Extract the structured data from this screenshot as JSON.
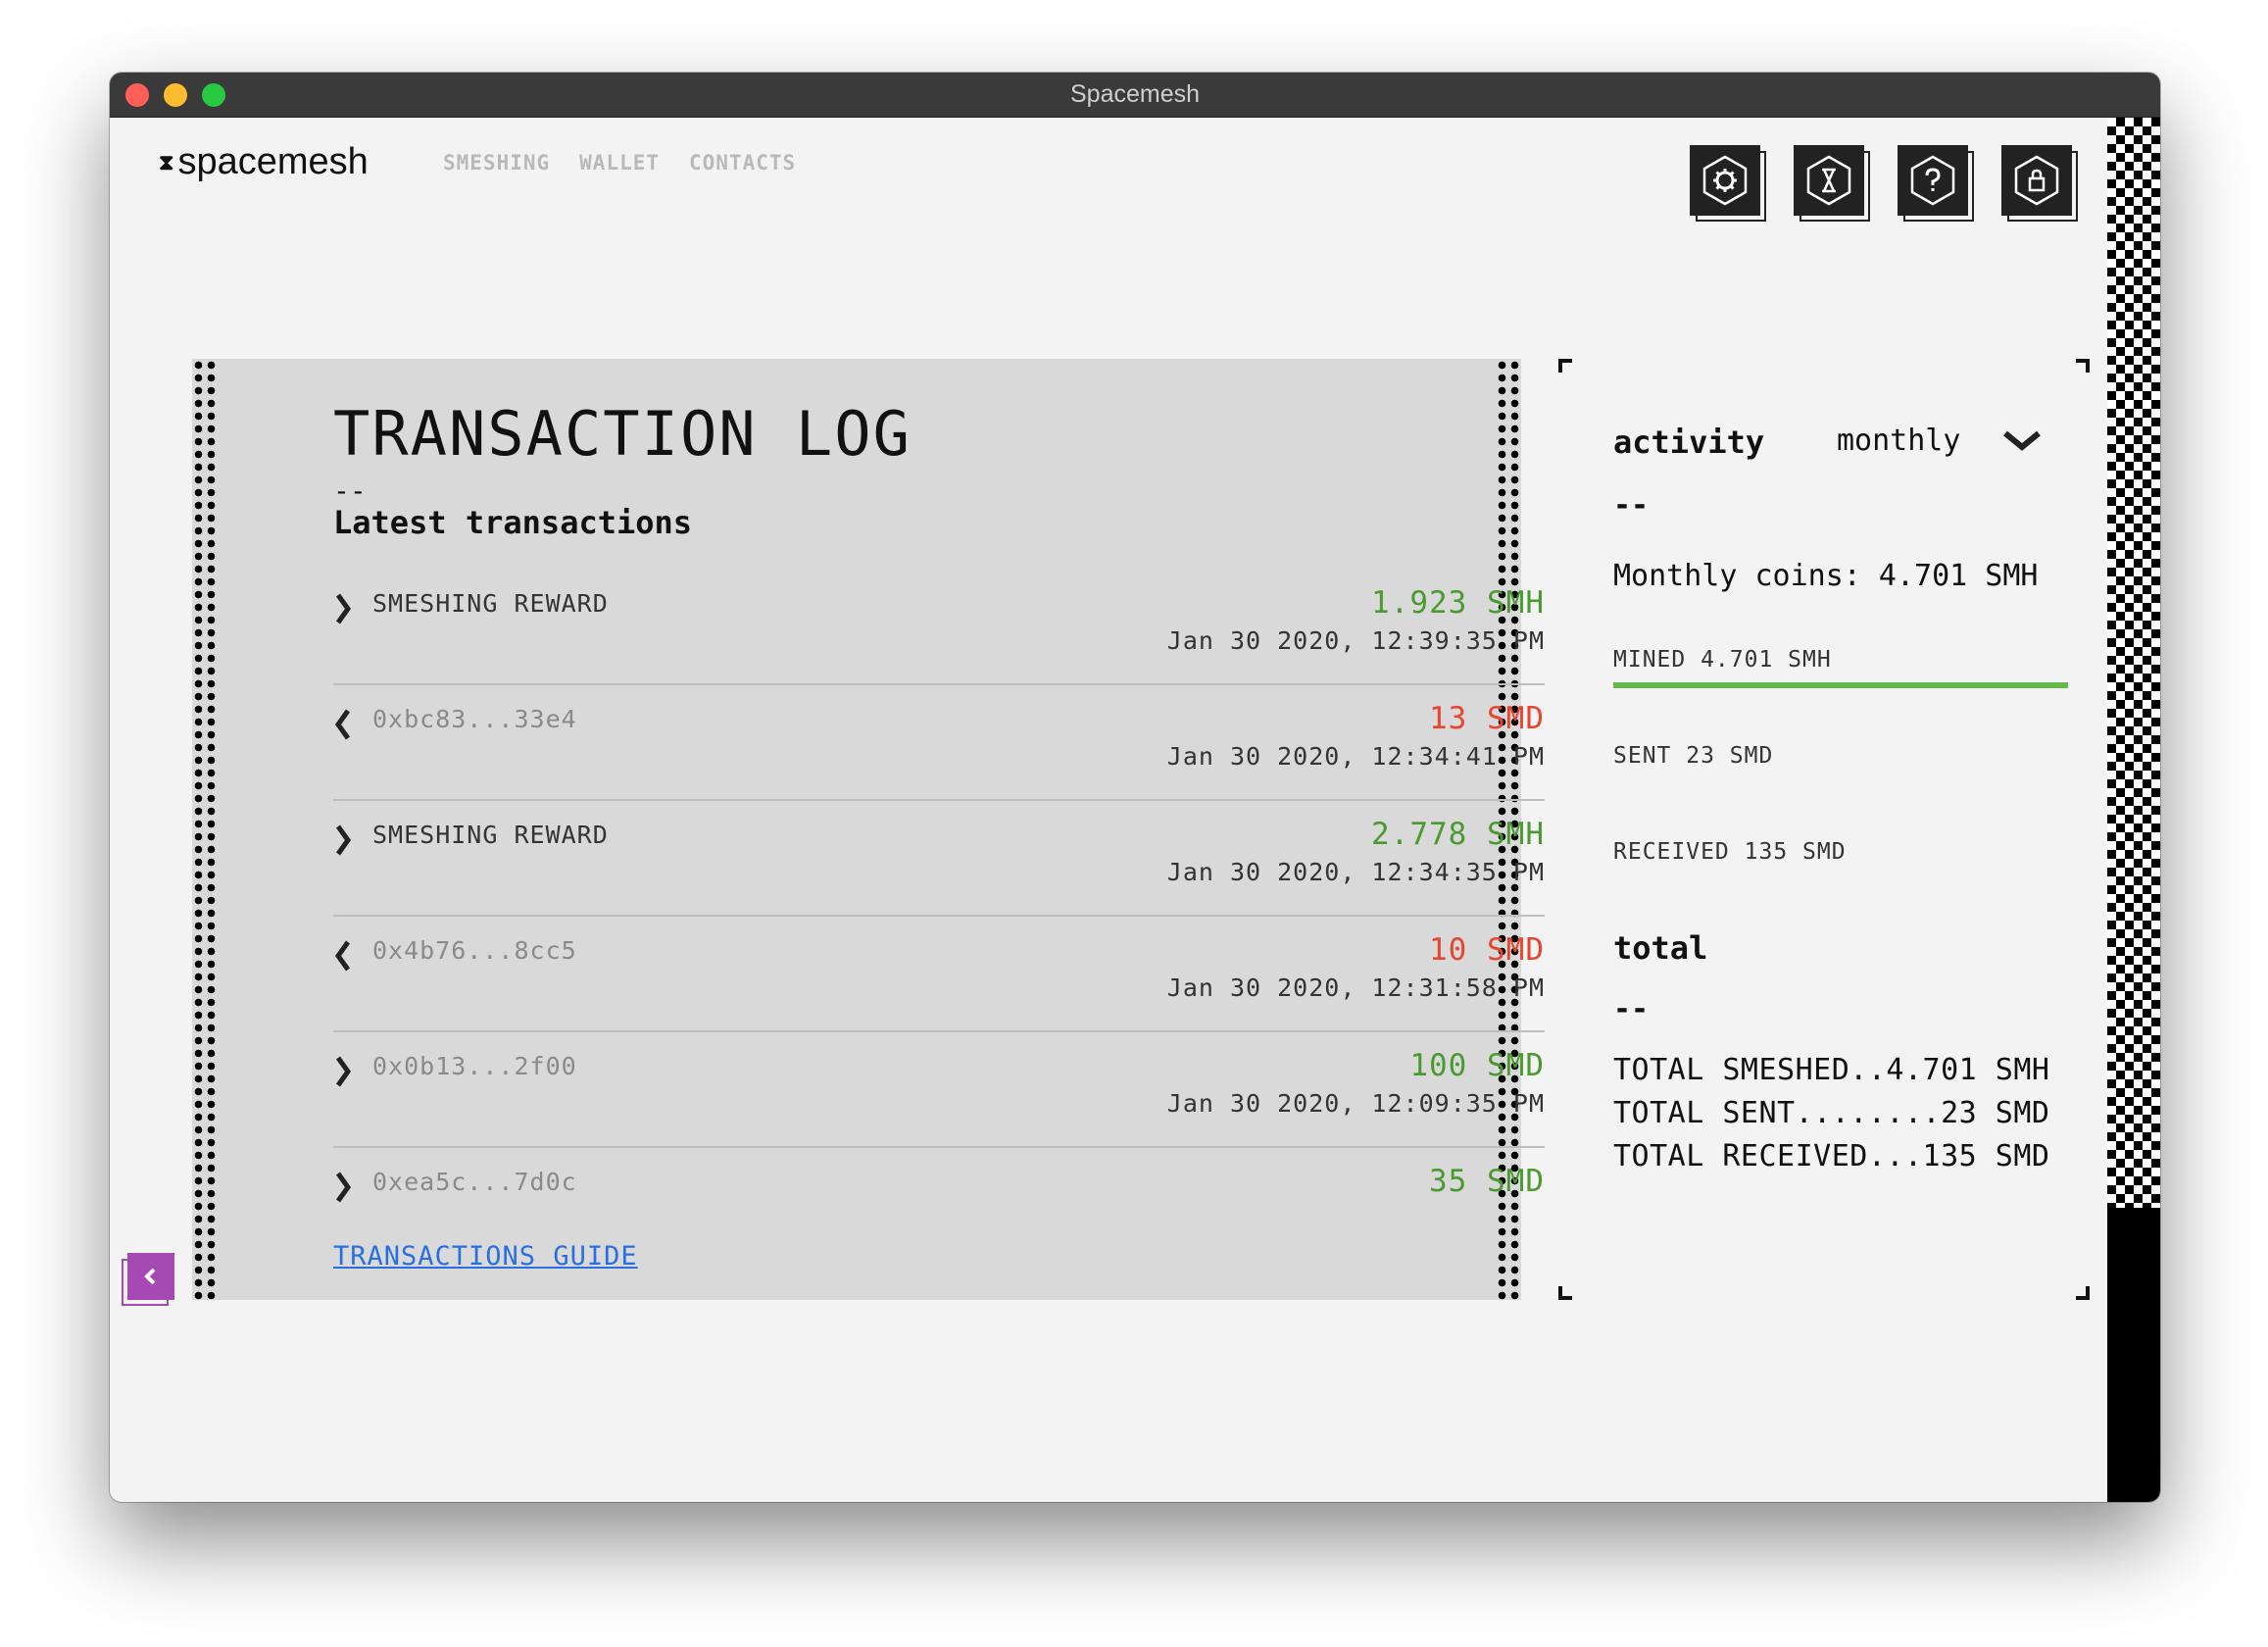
{
  "window": {
    "title": "Spacemesh"
  },
  "header": {
    "logo": "spacemesh",
    "nav": [
      "SMESHING",
      "WALLET",
      "CONTACTS"
    ],
    "icons": [
      "gear-icon",
      "hourglass-icon",
      "help-icon",
      "lock-icon"
    ]
  },
  "log": {
    "title": "TRANSACTION LOG",
    "dash": "--",
    "subtitle": "Latest transactions",
    "transactions": [
      {
        "direction": "in",
        "label": "SMESHING REWARD",
        "amount": "1.923 SMH",
        "date": "Jan 30 2020, 12:39:35 PM",
        "color": "#4a9a31"
      },
      {
        "direction": "out",
        "label": "0xbc83...33e4",
        "amount": "13 SMD",
        "date": "Jan 30 2020, 12:34:41 PM",
        "color": "#e8452f"
      },
      {
        "direction": "in",
        "label": "SMESHING REWARD",
        "amount": "2.778 SMH",
        "date": "Jan 30 2020, 12:34:35 PM",
        "color": "#4a9a31"
      },
      {
        "direction": "out",
        "label": "0x4b76...8cc5",
        "amount": "10 SMD",
        "date": "Jan 30 2020, 12:31:58 PM",
        "color": "#e8452f"
      },
      {
        "direction": "in",
        "label": "0x0b13...2f00",
        "amount": "100 SMD",
        "date": "Jan 30 2020, 12:09:35 PM",
        "color": "#4a9a31"
      },
      {
        "direction": "in",
        "label": "0xea5c...7d0c",
        "amount": "35 SMD",
        "date": "",
        "color": "#4a9a31"
      }
    ],
    "guide_link": "TRANSACTIONS GUIDE"
  },
  "activity": {
    "title": "activity",
    "period": "monthly",
    "dash": "--",
    "monthly_coins": "Monthly coins: 4.701 SMH",
    "mined": "MINED 4.701 SMH",
    "mined_fraction": 1.0,
    "sent": "SENT 23 SMD",
    "received": "RECEIVED 135 SMD",
    "total_title": "total",
    "total_dash": "--",
    "totals": [
      "TOTAL SMESHED..4.701 SMH",
      "TOTAL SENT........23 SMD",
      "TOTAL RECEIVED...135 SMD"
    ]
  },
  "colors": {
    "accent_purple": "#a44ab2",
    "positive": "#4a9a31",
    "negative": "#e8452f",
    "link": "#2a6fe0"
  }
}
